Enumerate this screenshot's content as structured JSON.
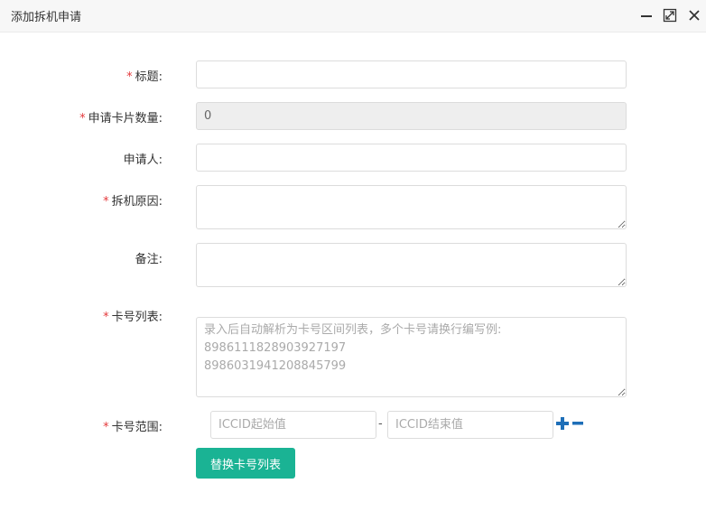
{
  "dialog": {
    "title": "添加拆机申请"
  },
  "form": {
    "required_mark": "*",
    "title_label": "标题:",
    "title_value": "",
    "card_count_label": "申请卡片数量:",
    "card_count_value": "0",
    "applicant_label": "申请人:",
    "applicant_value": "",
    "reason_label": "拆机原因:",
    "reason_value": "",
    "remark_label": "备注:",
    "remark_value": "",
    "card_list_label": "卡号列表:",
    "card_list_placeholder": "录入后自动解析为卡号区间列表，多个卡号请换行编写例:\n8986111828903927197\n8986031941208845799",
    "card_range_label": "卡号范围:",
    "range_start_placeholder": "ICCID起始值",
    "range_separator": "-",
    "range_end_placeholder": "ICCID结束值",
    "replace_button_label": "替换卡号列表"
  },
  "icons": {
    "minimize": "minimize-icon",
    "maximize": "maximize-icon",
    "close": "close-icon",
    "add": "plus-icon",
    "remove": "minus-icon"
  },
  "colors": {
    "required": "#e4393c",
    "primary_button": "#1ab394",
    "range_icons": "#1e6fb8"
  }
}
